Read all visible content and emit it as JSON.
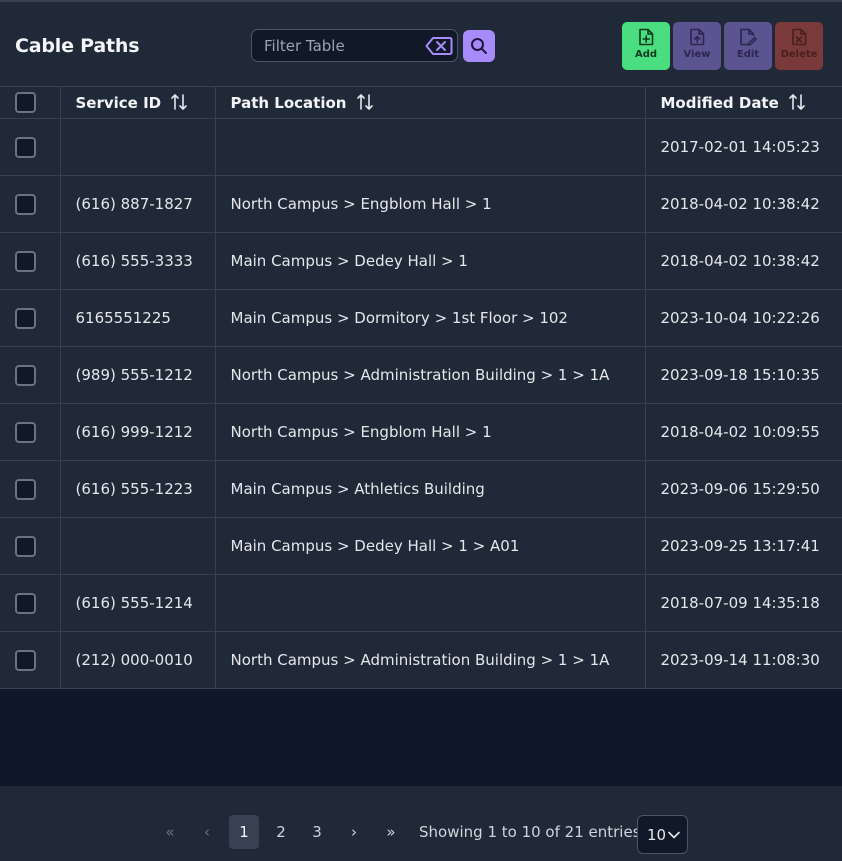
{
  "header": {
    "title": "Cable Paths",
    "filter_placeholder": "Filter Table",
    "filter_value": ""
  },
  "actions": {
    "add": "Add",
    "view": "View",
    "edit": "Edit",
    "delete": "Delete"
  },
  "columns": [
    "Service ID",
    "Path Location",
    "Modified Date"
  ],
  "rows": [
    {
      "service_id": "",
      "path": "",
      "modified": "2017-02-01 14:05:23"
    },
    {
      "service_id": "(616) 887-1827",
      "path": "North Campus > Engblom Hall > 1",
      "modified": "2018-04-02 10:38:42"
    },
    {
      "service_id": "(616) 555-3333",
      "path": "Main Campus > Dedey Hall > 1",
      "modified": "2018-04-02 10:38:42"
    },
    {
      "service_id": "6165551225",
      "path": "Main Campus > Dormitory > 1st Floor > 102",
      "modified": "2023-10-04 10:22:26"
    },
    {
      "service_id": "(989) 555-1212",
      "path": "North Campus > Administration Building > 1 > 1A",
      "modified": "2023-09-18 15:10:35"
    },
    {
      "service_id": "(616) 999-1212",
      "path": "North Campus > Engblom Hall > 1",
      "modified": "2018-04-02 10:09:55"
    },
    {
      "service_id": "(616) 555-1223",
      "path": "Main Campus > Athletics Building",
      "modified": "2023-09-06 15:29:50"
    },
    {
      "service_id": "",
      "path": "Main Campus > Dedey Hall > 1 > A01",
      "modified": "2023-09-25 13:17:41"
    },
    {
      "service_id": "(616) 555-1214",
      "path": "",
      "modified": "2018-07-09 14:35:18"
    },
    {
      "service_id": "(212) 000-0010",
      "path": "North Campus > Administration Building > 1 > 1A",
      "modified": "2023-09-14 11:08:30"
    }
  ],
  "pagination": {
    "first": "«",
    "prev": "‹",
    "pages": [
      "1",
      "2",
      "3"
    ],
    "current_page": "1",
    "next": "›",
    "last": "»",
    "summary": "Showing 1 to 10 of 21 entries",
    "page_size": "10"
  },
  "colors": {
    "accent": "#a78bfa",
    "add": "#4ade80",
    "view_edit": "#5b5491",
    "delete": "#7a3a3a",
    "surface": "#1f2937",
    "background": "#0f1729"
  },
  "icons": {
    "clear": "backspace-x-icon",
    "search": "search-icon",
    "add": "file-plus-icon",
    "view": "file-upload-icon",
    "edit": "file-edit-icon",
    "delete": "file-x-icon",
    "sort": "sort-arrows-icon",
    "select": "chevron-down-icon"
  }
}
